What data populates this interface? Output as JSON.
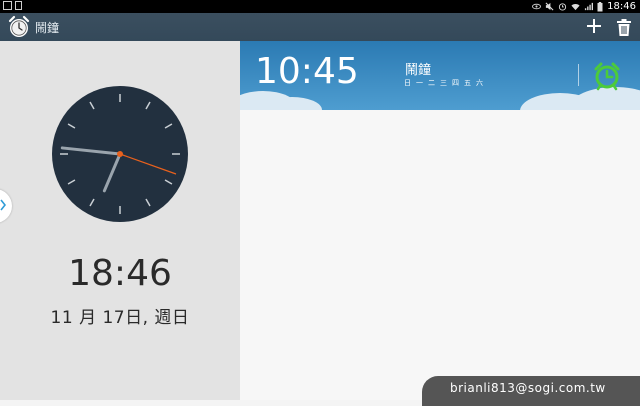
{
  "status_bar": {
    "time": "18:46"
  },
  "action_bar": {
    "title": "鬧鐘",
    "add_icon": "plus-icon",
    "delete_icon": "trash-icon"
  },
  "left_pane": {
    "time": "18:46",
    "date": "11 月 17日, 週日",
    "clock": {
      "hour": 6,
      "minute": 46
    }
  },
  "alarm": {
    "time": "10:45",
    "name": "鬧鐘",
    "days": [
      "日",
      "一",
      "二",
      "三",
      "四",
      "五",
      "六"
    ],
    "enabled": true
  },
  "watermark": "brianli813@sogi.com.tw"
}
